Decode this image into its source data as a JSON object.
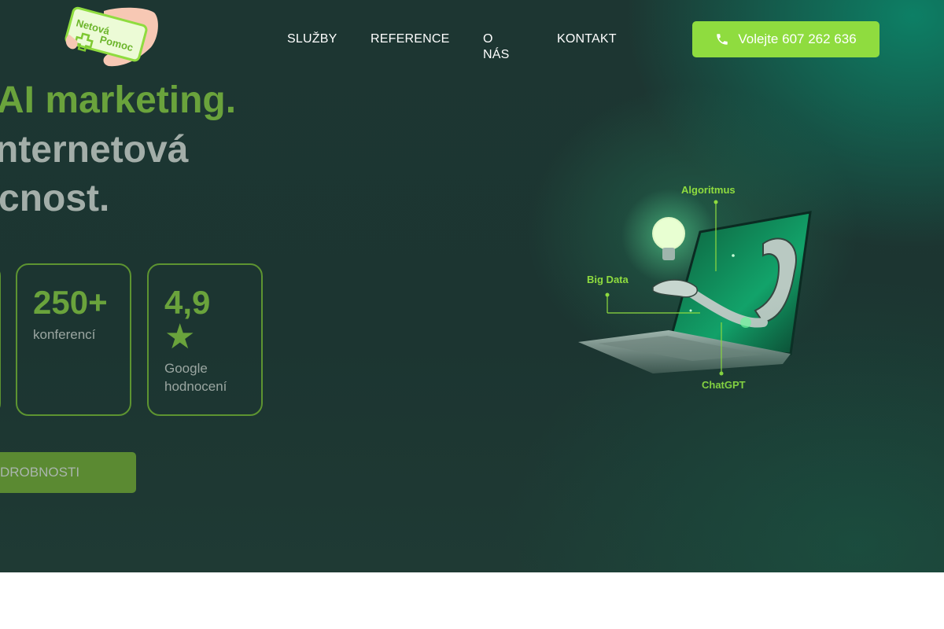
{
  "header": {
    "logo": {
      "line1": "Netová",
      "line2": "Pomoc"
    },
    "nav": [
      {
        "label": "SLUŽBY"
      },
      {
        "label": "REFERENCE"
      },
      {
        "label": "O NÁS"
      },
      {
        "label": "KONTAKT"
      }
    ],
    "call_button": {
      "label": "Volejte 607 262 636",
      "icon": "phone-icon"
    }
  },
  "hero": {
    "headline": {
      "line1": "AI marketing.",
      "line2": "nternetová",
      "line3": "cnost."
    },
    "stats": [
      {
        "value": "250+",
        "label": "konferencí"
      },
      {
        "value": "4,9",
        "star": "★",
        "label": "Google hodnocení"
      }
    ],
    "details_button": {
      "label": "DROBNOSTI"
    },
    "illustration": {
      "labels": {
        "algorithm": "Algoritmus",
        "big_data": "Big Data",
        "chatgpt": "ChatGPT"
      }
    }
  },
  "colors": {
    "accent": "#8fdc3f",
    "headline_green": "#6aa33c",
    "hero_bg": "#1d3632",
    "muted_text": "#a3aea9"
  }
}
